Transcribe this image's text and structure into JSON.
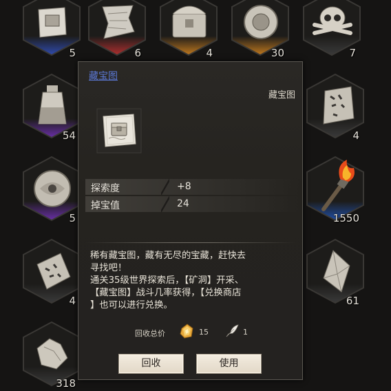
{
  "slots": [
    {
      "icon": "treasure-map-icon",
      "count": "5",
      "accent": "#2f4bb0"
    },
    {
      "icon": "torn-scroll-icon",
      "count": "6",
      "accent": "#b02f2f"
    },
    {
      "icon": "treasure-chest-icon",
      "count": "4",
      "accent": "#c27a1e"
    },
    {
      "icon": "round-relic-icon",
      "count": "30",
      "accent": "#c27a1e"
    },
    {
      "icon": "skull-crossbones-icon",
      "count": "7",
      "accent": "#3a3a3a"
    },
    {
      "icon": "potion-bottle-icon",
      "count": "54",
      "accent": "#6a2fa8"
    },
    {
      "icon": "rune-stone-icon",
      "count": "4",
      "accent": "#3a3a3a"
    },
    {
      "icon": "eye-relic-icon",
      "count": "5",
      "accent": "#6a2fa8"
    },
    {
      "icon": "burning-torch-icon",
      "count": "1550",
      "accent": "#1f4fa8"
    },
    {
      "icon": "rune-tablet-icon",
      "count": "4",
      "accent": "#3a3a3a"
    },
    {
      "icon": "crystal-shard-icon",
      "count": "61",
      "accent": "#3a3a3a"
    },
    {
      "icon": "ore-rock-icon",
      "count": "318",
      "accent": "#3a3a3a"
    }
  ],
  "tooltip": {
    "title": "藏宝图",
    "subtitle": "藏宝图",
    "item_icon": "treasure-map-icon",
    "stats": [
      {
        "label": "探索度",
        "value": "+8"
      },
      {
        "label": "掉宝值",
        "value": "24"
      }
    ],
    "description": [
      "稀有藏宝图，藏有无尽的宝藏，赶快去",
      "寻找吧！",
      "通关35级世界探索后，【矿洞】开采、",
      "【藏宝图】战斗几率获得，【兑换商店",
      "】也可以进行兑换。"
    ],
    "recycle": {
      "label": "回收总价",
      "gold_icon": "gold-ingot-icon",
      "gold_value": "15",
      "feather_icon": "white-feather-icon",
      "feather_value": "1"
    },
    "buttons": {
      "recycle": "回收",
      "use": "使用"
    }
  }
}
